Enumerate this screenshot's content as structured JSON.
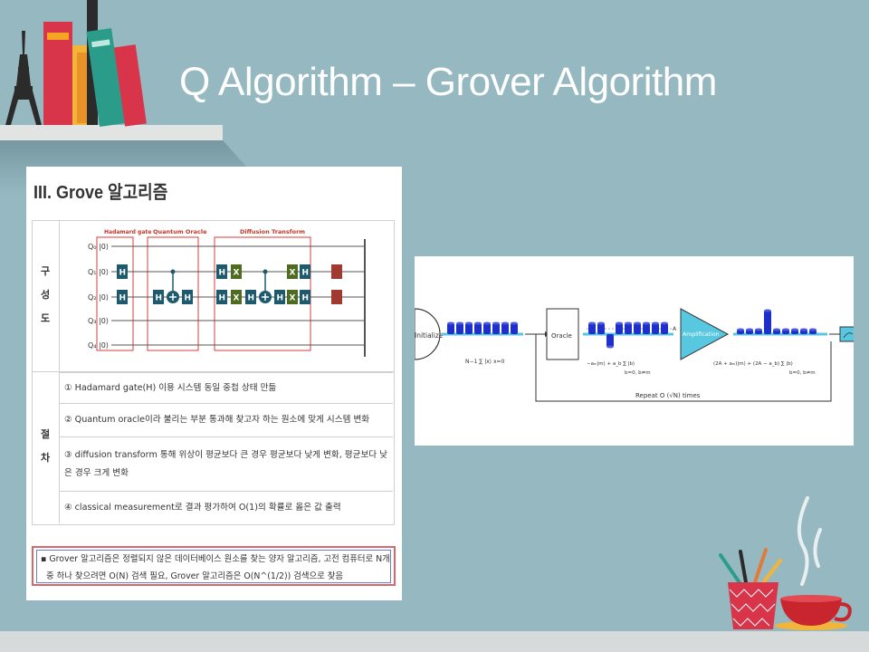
{
  "slide": {
    "title": "Q Algorithm – Grover  Algorithm"
  },
  "left_panel": {
    "heading": "III. Grove 알고리즘",
    "section_structure": [
      "구",
      "성",
      "도"
    ],
    "section_procedure": [
      "절",
      "차"
    ],
    "circuit": {
      "box_labels": [
        "Hadamard gate",
        "Quantum Oracle",
        "Diffusion Transform"
      ],
      "qubits": [
        "Q₀ |0⟩",
        "Q₁ |0⟩",
        "Q₂ |0⟩",
        "Q₃ |0⟩",
        "Q₄ |0⟩"
      ]
    },
    "steps": [
      "① Hadamard gate(H) 이용 시스템 동일 중첩 상태 만듦",
      "② Quantum oracle이라 불리는 부분 통과해 찾고자 하는 원소에 맞게 시스템 변화",
      "③ diffusion transform 통해 위상이 평균보다 큰 경우 평균보다 낮게 변화, 평균보다 낮은 경우 크게 변화",
      "④ classical measurement로 결과 평가하여 O(1)의 확률로 옳은 값 출력"
    ],
    "note_line1": "▪  Grover 알고리즘은 정렬되지 않은 데이터베이스 원소를 찾는 양자 알고리즘, 고전 컴퓨터로 N개의 원소",
    "note_line2": "중 하나 찾으려면 O(N) 검색 필요, Grover 알고리즘은 O(N^(1/2)) 검색으로 찾음"
  },
  "right_panel": {
    "stage_labels": [
      "Initialize",
      "Oracle",
      "Amplification"
    ],
    "marker": "A",
    "formula1": "N−1  ∑  |x⟩  x=0",
    "formula2": "−aₘ|m⟩ + a_b ∑ |b⟩",
    "formula2_sub": "b=0, b≠m",
    "formula3": "(2A + aₘ)|m⟩ + (2A − a_b) ∑ |b⟩",
    "formula3_sub": "b=0, b≠m",
    "repeat_label": "Repeat O (√N) times"
  },
  "colors": {
    "background": "#96b9c1",
    "bar_blue": "#1f2fc9",
    "gate_teal": "#1d5a6e",
    "gate_olive": "#4e6b1f",
    "measure_red": "#a0392f",
    "box_red": "#d43c3c",
    "stage_cyan": "#58c8e0"
  }
}
